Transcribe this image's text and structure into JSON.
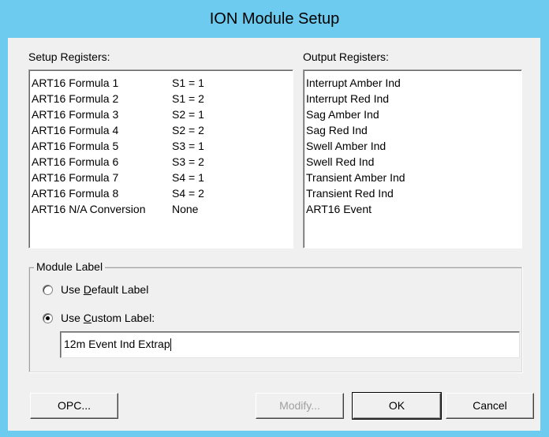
{
  "window": {
    "title": "ION Module Setup"
  },
  "setup_registers": {
    "label": "Setup Registers:",
    "items": [
      {
        "name": "ART16 Formula 1",
        "value": "S1 = 1"
      },
      {
        "name": "ART16 Formula 2",
        "value": "S1 = 2"
      },
      {
        "name": "ART16 Formula 3",
        "value": "S2 = 1"
      },
      {
        "name": "ART16 Formula 4",
        "value": "S2 = 2"
      },
      {
        "name": "ART16 Formula 5",
        "value": "S3 = 1"
      },
      {
        "name": "ART16 Formula 6",
        "value": "S3 = 2"
      },
      {
        "name": "ART16 Formula 7",
        "value": "S4 = 1"
      },
      {
        "name": "ART16 Formula 8",
        "value": "S4 = 2"
      },
      {
        "name": "ART16 N/A Conversion",
        "value": "None"
      }
    ]
  },
  "output_registers": {
    "label": "Output Registers:",
    "items": [
      "Interrupt Amber Ind",
      "Interrupt Red Ind",
      "Sag Amber Ind",
      "Sag Red Ind",
      "Swell Amber Ind",
      "Swell Red Ind",
      "Transient Amber Ind",
      "Transient Red Ind",
      "ART16 Event"
    ]
  },
  "module_label": {
    "group_title": "Module Label",
    "default_option": {
      "pre": "Use ",
      "hotkey": "D",
      "post": "efault Label",
      "selected": false
    },
    "custom_option": {
      "pre": "Use ",
      "hotkey": "C",
      "post": "ustom Label:",
      "selected": true
    },
    "custom_value": "12m Event Ind Extrap"
  },
  "buttons": {
    "opc": "OPC...",
    "modify": "Modify...",
    "ok": "OK",
    "cancel": "Cancel"
  }
}
